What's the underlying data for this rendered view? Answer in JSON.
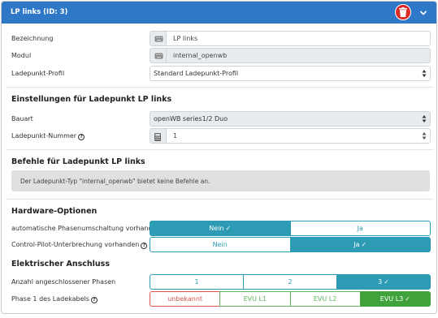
{
  "header": {
    "title": "LP links (ID: 3)",
    "background": "#2e78c7",
    "delete_color": "#e02b27"
  },
  "general": {
    "bezeichnung_label": "Bezeichnung",
    "bezeichnung_value": "LP links",
    "modul_label": "Modul",
    "modul_value": "internal_openwb",
    "profil_label": "Ladepunkt-Profil",
    "profil_value": "Standard Ladepunkt-Profil"
  },
  "settings": {
    "title": "Einstellungen für Ladepunkt LP links",
    "bauart_label": "Bauart",
    "bauart_value": "openWB series1/2 Duo",
    "nummer_label": "Ladepunkt-Nummer",
    "nummer_value": "1"
  },
  "commands": {
    "title": "Befehle für Ladepunkt LP links",
    "info": "Der Ladepunkt-Typ \"internal_openwb\" bietet keine Befehle an."
  },
  "hardware": {
    "title": "Hardware-Optionen",
    "phase_switch_label": "automatische Phasenumschaltung vorhanden",
    "phase_switch_options": [
      "Nein",
      "Ja"
    ],
    "phase_switch_selected": "Nein",
    "cp_label": "Control-Pilot-Unterbrechung vorhanden",
    "cp_options": [
      "Nein",
      "Ja"
    ],
    "cp_selected": "Ja"
  },
  "electric": {
    "title": "Elektrischer Anschluss",
    "phases_label": "Anzahl angeschlossener Phasen",
    "phases_options": [
      "1",
      "2",
      "3"
    ],
    "phases_selected": "3",
    "phase1_label": "Phase 1 des Ladekabels",
    "phase1_options": [
      "unbekannt",
      "EVU L1",
      "EVU L2",
      "EVU L3"
    ],
    "phase1_selected": "EVU L3"
  },
  "colors": {
    "accent": "#2c9bb3",
    "success": "#3fa23a",
    "danger": "#d9534f"
  }
}
